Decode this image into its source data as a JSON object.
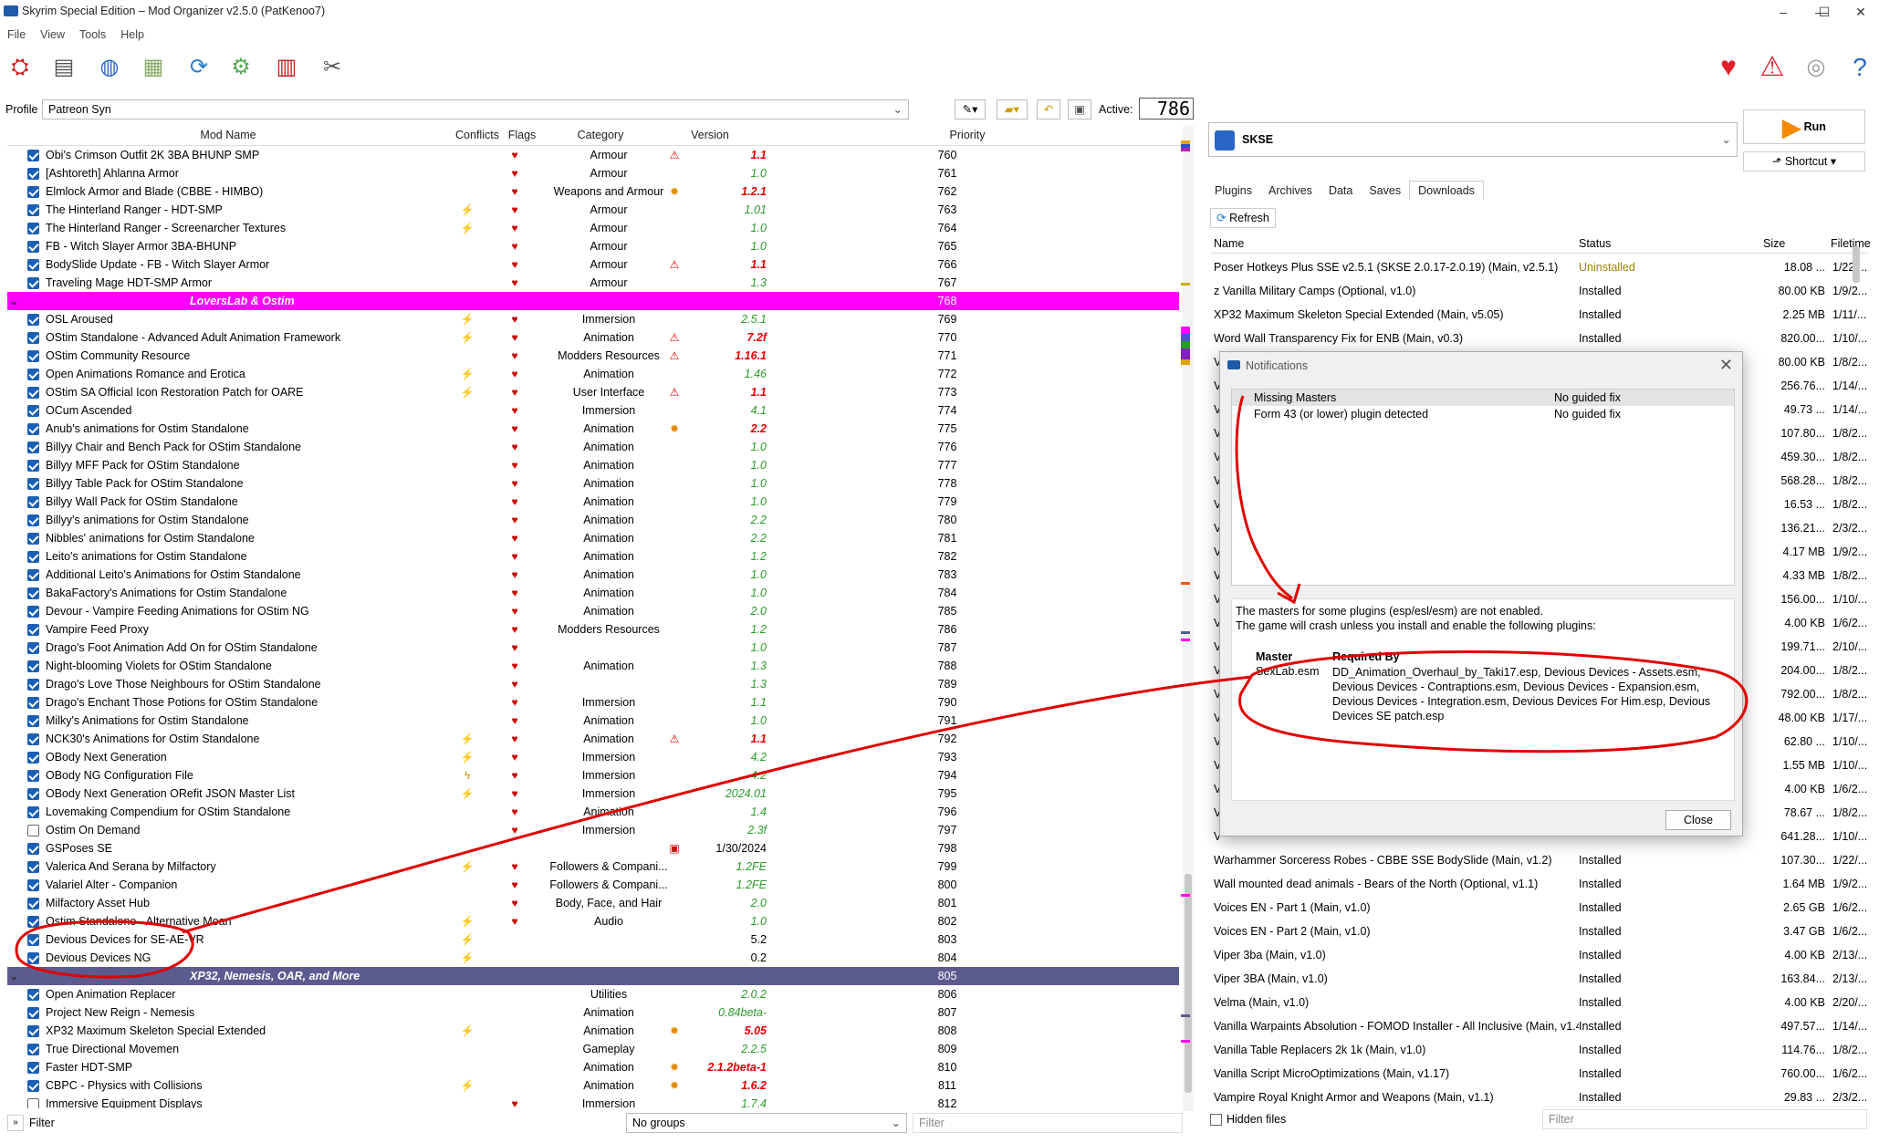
{
  "window": {
    "title": "Skyrim Special Edition – Mod Organizer v2.5.0 (PatKenoo7)"
  },
  "menu": [
    "File",
    "View",
    "Tools",
    "Help"
  ],
  "profile": {
    "label": "Profile",
    "value": "Patreon Syn",
    "active_label": "Active:",
    "active_count": "786"
  },
  "columns": {
    "name": "Mod Name",
    "conflicts": "Conflicts",
    "flags": "Flags",
    "category": "Category",
    "version": "Version",
    "priority": "Priority"
  },
  "mods": [
    {
      "t": "mod",
      "name": "Obi's Crimson Outfit 2K 3BA BHUNP SMP",
      "flag": "♥",
      "cat": "Armour",
      "vw": "⚠",
      "ver": "1.1",
      "vc": "red",
      "pr": "760"
    },
    {
      "t": "mod",
      "name": "[Ashtoreth] Ahlanna Armor",
      "flag": "♥",
      "cat": "Armour",
      "ver": "1.0",
      "pr": "761"
    },
    {
      "t": "mod",
      "name": "Elmlock Armor and Blade (CBBE - HIMBO)",
      "flag": "♥",
      "cat": "Weapons and Armour",
      "vw": "✹",
      "ver": "1.2.1",
      "vc": "red",
      "pr": "762"
    },
    {
      "t": "mod",
      "name": "The Hinterland Ranger - HDT-SMP",
      "cf": "⚡",
      "flag": "♥",
      "cat": "Armour",
      "ver": "1.01",
      "pr": "763"
    },
    {
      "t": "mod",
      "name": "The Hinterland Ranger - Screenarcher Textures",
      "cf": "⚡",
      "flag": "♥",
      "cat": "Armour",
      "ver": "1.0",
      "pr": "764"
    },
    {
      "t": "mod",
      "name": "FB - Witch Slayer Armor 3BA-BHUNP",
      "flag": "♥",
      "cat": "Armour",
      "ver": "1.0",
      "pr": "765"
    },
    {
      "t": "mod",
      "name": "BodySlide Update - FB - Witch Slayer Armor",
      "flag": "♥",
      "cat": "Armour",
      "vw": "⚠",
      "ver": "1.1",
      "vc": "red",
      "pr": "766"
    },
    {
      "t": "mod",
      "name": "Traveling Mage HDT-SMP Armor",
      "flag": "♥",
      "cat": "Armour",
      "ver": "1.3",
      "pr": "767"
    },
    {
      "t": "sep",
      "name": "LoversLab & Ostim",
      "pr": "768"
    },
    {
      "t": "mod",
      "name": "OSL Aroused",
      "cf": "⚡",
      "flag": "♥",
      "cat": "Immersion",
      "ver": "2.5.1",
      "pr": "769"
    },
    {
      "t": "mod",
      "name": "OStim Standalone - Advanced Adult Animation Framework",
      "cf": "⚡",
      "flag": "♥",
      "cat": "Animation",
      "vw": "⚠",
      "ver": "7.2f",
      "vc": "red",
      "pr": "770"
    },
    {
      "t": "mod",
      "name": "OStim Community Resource",
      "flag": "♥",
      "cat": "Modders Resources",
      "vw": "⚠",
      "ver": "1.16.1",
      "vc": "red",
      "pr": "771"
    },
    {
      "t": "mod",
      "name": "Open Animations Romance and Erotica",
      "cf": "⚡",
      "flag": "♥",
      "cat": "Animation",
      "ver": "1.46",
      "pr": "772"
    },
    {
      "t": "mod",
      "name": "OStim SA Official Icon Restoration Patch for OARE",
      "cf": "⚡",
      "flag": "♥",
      "cat": "User Interface",
      "vw": "⚠",
      "ver": "1.1",
      "vc": "red",
      "pr": "773"
    },
    {
      "t": "mod",
      "name": "OCum Ascended",
      "flag": "♥",
      "cat": "Immersion",
      "ver": "4.1",
      "pr": "774"
    },
    {
      "t": "mod",
      "name": "Anub's animations for Ostim Standalone",
      "flag": "♥",
      "cat": "Animation",
      "vw": "✹",
      "ver": "2.2",
      "vc": "red",
      "pr": "775"
    },
    {
      "t": "mod",
      "name": "Billyy Chair and Bench Pack for OStim Standalone",
      "flag": "♥",
      "cat": "Animation",
      "ver": "1.0",
      "pr": "776"
    },
    {
      "t": "mod",
      "name": "Billyy MFF Pack for OStim Standalone",
      "flag": "♥",
      "cat": "Animation",
      "ver": "1.0",
      "pr": "777"
    },
    {
      "t": "mod",
      "name": "Billyy Table Pack for OStim Standalone",
      "flag": "♥",
      "cat": "Animation",
      "ver": "1.0",
      "pr": "778"
    },
    {
      "t": "mod",
      "name": "Billyy Wall Pack for OStim Standalone",
      "flag": "♥",
      "cat": "Animation",
      "ver": "1.0",
      "pr": "779"
    },
    {
      "t": "mod",
      "name": "Billyy's animations for Ostim Standalone",
      "flag": "♥",
      "cat": "Animation",
      "ver": "2.2",
      "pr": "780"
    },
    {
      "t": "mod",
      "name": "Nibbles' animations for Ostim Standalone",
      "flag": "♥",
      "cat": "Animation",
      "ver": "2.2",
      "pr": "781"
    },
    {
      "t": "mod",
      "name": "Leito's animations for Ostim Standalone",
      "flag": "♥",
      "cat": "Animation",
      "ver": "1.2",
      "pr": "782"
    },
    {
      "t": "mod",
      "name": "Additional Leito's Animations for Ostim Standalone",
      "flag": "♥",
      "cat": "Animation",
      "ver": "1.0",
      "pr": "783"
    },
    {
      "t": "mod",
      "name": "BakaFactory's Animations for Ostim Standalone",
      "flag": "♥",
      "cat": "Animation",
      "ver": "1.0",
      "pr": "784"
    },
    {
      "t": "mod",
      "name": "Devour - Vampire Feeding Animations for OStim NG",
      "flag": "♥",
      "cat": "Animation",
      "ver": "2.0",
      "pr": "785"
    },
    {
      "t": "mod",
      "name": "Vampire Feed Proxy",
      "flag": "♥",
      "cat": "Modders Resources",
      "ver": "1.2",
      "pr": "786"
    },
    {
      "t": "mod",
      "name": "Drago's Foot Animation Add On for OStim Standalone",
      "flag": "♥",
      "cat": "",
      "ver": "1.0",
      "pr": "787"
    },
    {
      "t": "mod",
      "name": "Night-blooming Violets for OStim Standalone",
      "flag": "♥",
      "cat": "Animation",
      "ver": "1.3",
      "pr": "788"
    },
    {
      "t": "mod",
      "name": "Drago's Love Those Neighbours for OStim Standalone",
      "flag": "♥",
      "cat": "",
      "ver": "1.3",
      "pr": "789"
    },
    {
      "t": "mod",
      "name": "Drago's Enchant Those Potions for OStim Standalone",
      "flag": "♥",
      "cat": "Immersion",
      "ver": "1.1",
      "pr": "790"
    },
    {
      "t": "mod",
      "name": "Milky's Animations for Ostim Standalone",
      "flag": "♥",
      "cat": "Animation",
      "ver": "1.0",
      "pr": "791"
    },
    {
      "t": "mod",
      "name": "NCK30's Animations for Ostim Standalone",
      "cf": "⚡",
      "flag": "♥",
      "cat": "Animation",
      "vw": "⚠",
      "ver": "1.1",
      "vc": "red",
      "pr": "792"
    },
    {
      "t": "mod",
      "name": "OBody Next Generation",
      "cf": "⚡",
      "flag": "♥",
      "cat": "Immersion",
      "ver": "4.2",
      "pr": "793"
    },
    {
      "t": "mod",
      "name": "OBody NG Configuration File",
      "cf": "ϟ",
      "flag": "♥",
      "cat": "Immersion",
      "ver": "4.2",
      "pr": "794"
    },
    {
      "t": "mod",
      "name": "OBody Next Generation ORefit JSON Master List",
      "cf": "⚡",
      "flag": "♥",
      "cat": "Immersion",
      "ver": "2024.01",
      "pr": "795"
    },
    {
      "t": "mod",
      "name": "Lovemaking Compendium for OStim Standalone",
      "flag": "♥",
      "cat": "Animation",
      "ver": "1.4",
      "pr": "796"
    },
    {
      "t": "mod",
      "off": true,
      "name": "Ostim On Demand",
      "flag": "♥",
      "cat": "Immersion",
      "ver": "2.3f",
      "pr": "797"
    },
    {
      "t": "mod",
      "name": "GSPoses SE",
      "flag": "",
      "cat": "",
      "vw": "▣",
      "ver": "1/30/2024",
      "vc": "blk",
      "pr": "798"
    },
    {
      "t": "mod",
      "name": "Valerica And Serana by Milfactory",
      "cf": "⚡",
      "flag": "♥",
      "cat": "Followers & Compani...",
      "ver": "1.2FE",
      "pr": "799"
    },
    {
      "t": "mod",
      "name": "Valariel Alter - Companion",
      "flag": "♥",
      "cat": "Followers & Compani...",
      "ver": "1.2FE",
      "pr": "800"
    },
    {
      "t": "mod",
      "name": "Milfactory Asset Hub",
      "flag": "♥",
      "cat": "Body, Face, and Hair",
      "ver": "2.0",
      "pr": "801"
    },
    {
      "t": "mod",
      "name": "Ostim Standalone - Alternative Moan",
      "cf": "⚡",
      "flag": "♥",
      "cat": "Audio",
      "ver": "1.0",
      "pr": "802"
    },
    {
      "t": "mod",
      "name": "Devious Devices for SE-AE-VR",
      "cf": "⚡",
      "flag": "",
      "cat": "",
      "ver": "5.2",
      "vc": "blk",
      "pr": "803"
    },
    {
      "t": "mod",
      "name": "Devious Devices NG",
      "cf": "⚡",
      "flag": "",
      "cat": "",
      "ver": "0.2",
      "vc": "blk",
      "pr": "804"
    },
    {
      "t": "sep2",
      "name": "XP32, Nemesis, OAR, and More",
      "pr": "805"
    },
    {
      "t": "mod",
      "name": "Open Animation Replacer",
      "flag": "",
      "cat": "Utilities",
      "ver": "2.0.2",
      "pr": "806"
    },
    {
      "t": "mod",
      "name": "Project New Reign - Nemesis",
      "flag": "",
      "cat": "Animation",
      "ver": "0.84beta-",
      "pr": "807"
    },
    {
      "t": "mod",
      "name": "XP32 Maximum Skeleton Special Extended",
      "cf": "⚡",
      "flag": "",
      "cat": "Animation",
      "vw": "✹",
      "ver": "5.05",
      "vc": "red",
      "pr": "808"
    },
    {
      "t": "mod",
      "name": "True Directional Movemen",
      "flag": "",
      "cat": "Gameplay",
      "ver": "2.2.5",
      "pr": "809"
    },
    {
      "t": "mod",
      "name": "Faster HDT-SMP",
      "flag": "",
      "cat": "Animation",
      "vw": "✹",
      "ver": "2.1.2beta-1",
      "vc": "red",
      "pr": "810"
    },
    {
      "t": "mod",
      "name": "CBPC - Physics with Collisions",
      "cf": "⚡",
      "flag": "",
      "cat": "Animation",
      "vw": "✹",
      "ver": "1.6.2",
      "vc": "red",
      "pr": "811"
    },
    {
      "t": "mod",
      "off": true,
      "name": "Immersive Equipment Displays",
      "flag": "♥",
      "cat": "Immersion",
      "ver": "1.7.4",
      "pr": "812"
    }
  ],
  "bottom": {
    "filter_label": "Filter",
    "groups": "No groups",
    "filter_placeholder": "Filter"
  },
  "run": {
    "executable": "SKSE",
    "run_label": "Run",
    "shortcut_label": "Shortcut"
  },
  "tabs": [
    "Plugins",
    "Archives",
    "Data",
    "Saves",
    "Downloads"
  ],
  "refresh_label": "Refresh",
  "dl_columns": {
    "name": "Name",
    "status": "Status",
    "size": "Size",
    "filetime": "Filetime"
  },
  "downloads": [
    {
      "n": "Poser Hotkeys Plus SSE v2.5.1 (SKSE 2.0.17-2.0.19) (Main, v2.5.1)",
      "s": "Uninstalled",
      "z": "18.08 ...",
      "t": "1/22/..."
    },
    {
      "n": "z Vanilla Military Camps (Optional, v1.0)",
      "s": "Installed",
      "z": "80.00 KB",
      "t": "1/9/2..."
    },
    {
      "n": "XP32 Maximum Skeleton Special Extended (Main, v5.05)",
      "s": "Installed",
      "z": "2.25 MB",
      "t": "1/11/..."
    },
    {
      "n": "Word Wall Transparency Fix for ENB (Main, v0.3)",
      "s": "Installed",
      "z": "820.00...",
      "t": "1/10/..."
    },
    {
      "n": "V",
      "s": "",
      "z": "80.00 KB",
      "t": "1/8/2..."
    },
    {
      "n": "V",
      "s": "",
      "z": "256.76...",
      "t": "1/14/..."
    },
    {
      "n": "V",
      "s": "",
      "z": "49.73 ...",
      "t": "1/14/..."
    },
    {
      "n": "V",
      "s": "",
      "z": "107.80...",
      "t": "1/8/2..."
    },
    {
      "n": "V",
      "s": "",
      "z": "459.30...",
      "t": "1/8/2..."
    },
    {
      "n": "V",
      "s": "",
      "z": "568.28...",
      "t": "1/8/2..."
    },
    {
      "n": "V",
      "s": "",
      "z": "16.53 ...",
      "t": "1/8/2..."
    },
    {
      "n": "V",
      "s": "",
      "z": "136.21...",
      "t": "2/3/2..."
    },
    {
      "n": "V",
      "s": "",
      "z": "4.17 MB",
      "t": "1/9/2..."
    },
    {
      "n": "V",
      "s": "",
      "z": "4.33 MB",
      "t": "1/8/2..."
    },
    {
      "n": "V",
      "s": "",
      "z": "156.00...",
      "t": "1/10/..."
    },
    {
      "n": "V",
      "s": "",
      "z": "4.00 KB",
      "t": "1/6/2..."
    },
    {
      "n": "V",
      "s": "",
      "z": "199.71...",
      "t": "2/10/..."
    },
    {
      "n": "V",
      "s": "",
      "z": "204.00...",
      "t": "1/8/2..."
    },
    {
      "n": "V",
      "s": "",
      "z": "792.00...",
      "t": "1/8/2..."
    },
    {
      "n": "V",
      "s": "",
      "z": "48.00 KB",
      "t": "1/17/..."
    },
    {
      "n": "V",
      "s": "",
      "z": "62.80 ...",
      "t": "1/10/..."
    },
    {
      "n": "V",
      "s": "",
      "z": "1.55 MB",
      "t": "1/10/..."
    },
    {
      "n": "V",
      "s": "",
      "z": "4.00 KB",
      "t": "1/6/2..."
    },
    {
      "n": "V",
      "s": "",
      "z": "78.67 ...",
      "t": "1/8/2..."
    },
    {
      "n": "V",
      "s": "",
      "z": "641.28...",
      "t": "1/10/..."
    },
    {
      "n": "Warhammer Sorceress Robes - CBBE SSE BodySlide (Main, v1.2)",
      "s": "Installed",
      "z": "107.30...",
      "t": "1/22/..."
    },
    {
      "n": "Wall mounted dead animals - Bears of the North (Optional, v1.1)",
      "s": "Installed",
      "z": "1.64 MB",
      "t": "1/9/2..."
    },
    {
      "n": "Voices EN - Part 1 (Main, v1.0)",
      "s": "Installed",
      "z": "2.65 GB",
      "t": "1/6/2..."
    },
    {
      "n": "Voices EN - Part 2 (Main, v1.0)",
      "s": "Installed",
      "z": "3.47 GB",
      "t": "1/6/2..."
    },
    {
      "n": "Viper 3ba (Main, v1.0)",
      "s": "Installed",
      "z": "4.00 KB",
      "t": "2/13/..."
    },
    {
      "n": "Viper 3BA (Main, v1.0)",
      "s": "Installed",
      "z": "163.84...",
      "t": "2/13/..."
    },
    {
      "n": "Velma (Main, v1.0)",
      "s": "Installed",
      "z": "4.00 KB",
      "t": "2/20/..."
    },
    {
      "n": "Vanilla Warpaints Absolution - FOMOD Installer - All Inclusive (Main, v1.4)",
      "s": "Installed",
      "z": "497.57...",
      "t": "1/14/..."
    },
    {
      "n": "Vanilla Table Replacers 2k 1k (Main, v1.0)",
      "s": "Installed",
      "z": "114.76...",
      "t": "1/8/2..."
    },
    {
      "n": "Vanilla Script MicroOptimizations (Main, v1.17)",
      "s": "Installed",
      "z": "760.00...",
      "t": "1/6/2..."
    },
    {
      "n": "Vampire Royal Knight Armor and Weapons (Main, v1.1)",
      "s": "Installed",
      "z": "29.83 ...",
      "t": "2/3/2..."
    }
  ],
  "hidden_files_label": "Hidden files",
  "dl_filter_placeholder": "Filter",
  "notifications": {
    "title": "Notifications",
    "items": [
      {
        "name": "Missing Masters",
        "fix": "No guided fix"
      },
      {
        "name": "Form 43 (or lower) plugin detected",
        "fix": "No guided fix"
      }
    ],
    "desc1": "The masters for some plugins (esp/esl/esm) are not enabled.",
    "desc2": "The game will crash unless you install and enable the following plugins:",
    "master_header": "Master",
    "required_header": "Required By",
    "master": "SexLab.esm",
    "required": "DD_Animation_Overhaul_by_Taki17.esp, Devious Devices - Assets.esm, Devious Devices - Contraptions.esm, Devious Devices - Expansion.esm, Devious Devices - Integration.esm, Devious Devices For Him.esp, Devious Devices SE patch.esp",
    "close_label": "Close"
  },
  "colors": {
    "accent": "#1a5fb4",
    "annotation": "#e00000",
    "separator1": "#ff00ff",
    "separator2": "#5b5b8f",
    "installed": "#000000",
    "uninstalled": "#a08000"
  }
}
